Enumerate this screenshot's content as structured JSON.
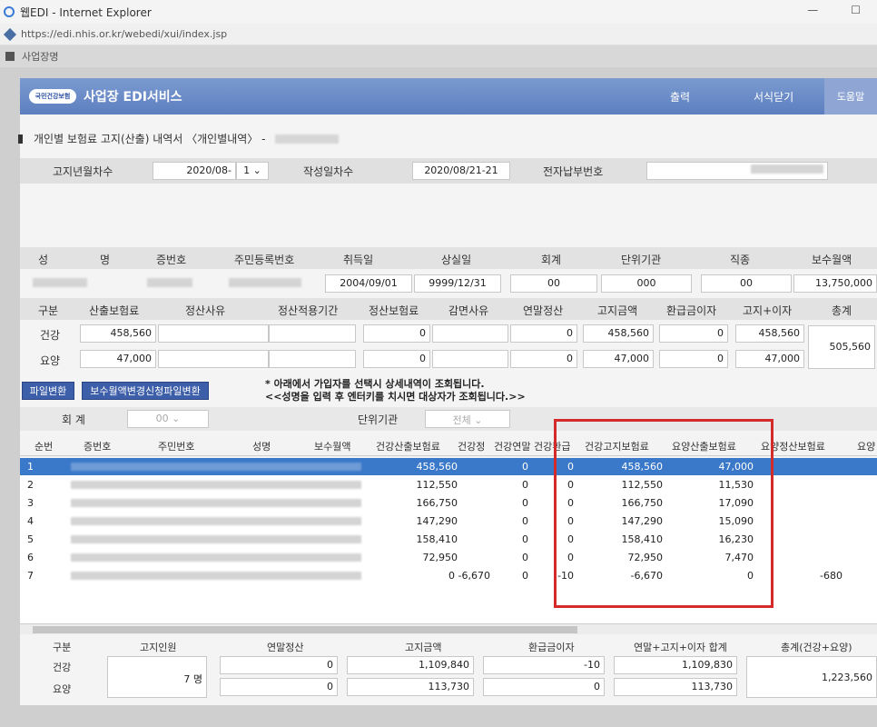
{
  "window": {
    "title": "웹EDI - Internet Explorer",
    "url": "https://edi.nhis.or.kr/webedi/xui/index.jsp",
    "tab": "사업장명"
  },
  "app": {
    "logo": "국민건강보험",
    "title": "사업장 EDI서비스",
    "print": "출력",
    "close_form": "서식닫기",
    "help": "도움말"
  },
  "page_title": "개인별 보험료 고지(산출) 내역서 〈개인별내역〉 -",
  "filters": {
    "notice_period_label": "고지년월차수",
    "notice_period_value": "2020/08-",
    "notice_period_seq": "1",
    "created_label": "작성일차수",
    "created_value": "2020/08/21-21",
    "payment_no_label": "전자납부번호"
  },
  "person_header": [
    "성",
    "명",
    "증번호",
    "주민등록번호",
    "취득일",
    "상실일",
    "회계",
    "단위기관",
    "직종",
    "보수월액"
  ],
  "person": {
    "acquired": "2004/09/01",
    "lost": "9999/12/31",
    "accounting": "00",
    "unit": "000",
    "job": "00",
    "monthly_pay": "13,750,000"
  },
  "calc_header": [
    "구분",
    "산출보험료",
    "정산사유",
    "정산적용기간",
    "정산보험료",
    "감면사유",
    "연말정산",
    "고지금액",
    "환급금이자",
    "고지+이자",
    "총계"
  ],
  "calc_rows": [
    {
      "label": "건강",
      "calc": "458,560",
      "settle_amt": "0",
      "year_end": "0",
      "notice": "458,560",
      "interest": "0",
      "notice_interest": "458,560"
    },
    {
      "label": "요양",
      "calc": "47,000",
      "settle_amt": "0",
      "year_end": "0",
      "notice": "47,000",
      "interest": "0",
      "notice_interest": "47,000"
    }
  ],
  "calc_total": "505,560",
  "buttons": {
    "file_convert": "파일변환",
    "pay_change_convert": "보수월액변경신청파일변환"
  },
  "notice_line1": "* 아래에서 가입자를 선택시 상세내역이 조회됩니다.",
  "notice_line2": "<<성명을 입력 후 엔터키를 치시면 대상자가 조회됩니다.>>",
  "filter2": {
    "account_label": "회 계",
    "account_value": "00",
    "unit_label": "단위기관",
    "unit_value": "전체"
  },
  "grid_header": [
    "순번",
    "증번호",
    "주민번호",
    "성명",
    "보수월액",
    "건강산출보험료",
    "건강정",
    "건강연말",
    "건강환급",
    "건강고지보험료",
    "요양산출보험료",
    "요양정산보험료",
    "요양"
  ],
  "grid_rows": [
    {
      "no": "1",
      "h_calc": "458,560",
      "h_settle": "0",
      "h_refund": "0",
      "h_notice": "458,560",
      "l_calc": "47,000",
      "l_settle": ""
    },
    {
      "no": "2",
      "h_calc": "112,550",
      "h_settle": "0",
      "h_refund": "0",
      "h_notice": "112,550",
      "l_calc": "11,530",
      "l_settle": ""
    },
    {
      "no": "3",
      "h_calc": "166,750",
      "h_settle": "0",
      "h_refund": "0",
      "h_notice": "166,750",
      "l_calc": "17,090",
      "l_settle": ""
    },
    {
      "no": "4",
      "h_calc": "147,290",
      "h_settle": "0",
      "h_refund": "0",
      "h_notice": "147,290",
      "l_calc": "15,090",
      "l_settle": ""
    },
    {
      "no": "5",
      "h_calc": "158,410",
      "h_settle": "0",
      "h_refund": "0",
      "h_notice": "158,410",
      "l_calc": "16,230",
      "l_settle": ""
    },
    {
      "no": "6",
      "h_calc": "72,950",
      "h_settle": "0",
      "h_refund": "0",
      "h_notice": "72,950",
      "l_calc": "7,470",
      "l_settle": ""
    },
    {
      "no": "7",
      "h_calc": "0 -6,670",
      "h_settle": "0",
      "h_refund": "-10",
      "h_notice": "-6,670",
      "l_calc": "0",
      "l_settle": "-680"
    }
  ],
  "summary_header": [
    "구분",
    "고지인원",
    "연말정산",
    "고지금액",
    "환급금이자",
    "연말+고지+이자 합계",
    "총계(건강+요양)"
  ],
  "summary_rows": [
    {
      "label": "건강",
      "year_end": "0",
      "notice": "1,109,840",
      "interest": "-10",
      "sum": "1,109,830"
    },
    {
      "label": "요양",
      "year_end": "0",
      "notice": "113,730",
      "interest": "0",
      "sum": "113,730"
    }
  ],
  "summary_people": "7 명",
  "summary_total": "1,223,560",
  "colors": {
    "header_blue": "#5d7fbf",
    "selected_row": "#3a78c9",
    "highlight_red": "#d42a2a"
  }
}
